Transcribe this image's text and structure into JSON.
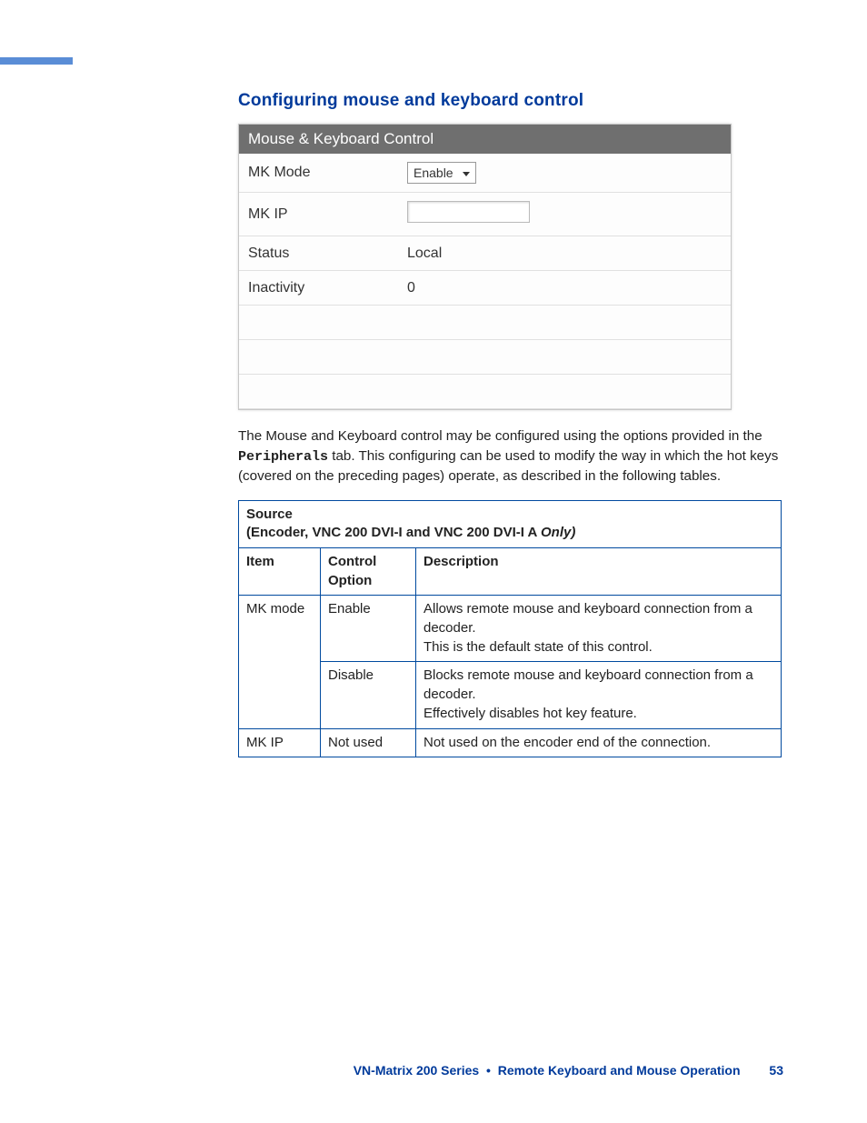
{
  "heading": "Configuring mouse and keyboard control",
  "panel": {
    "title": "Mouse & Keyboard Control",
    "rows": {
      "mk_mode_label": "MK Mode",
      "mk_mode_value": "Enable",
      "mk_ip_label": "MK IP",
      "mk_ip_value": "",
      "status_label": "Status",
      "status_value": "Local",
      "inactivity_label": "Inactivity",
      "inactivity_value": "0"
    }
  },
  "body": {
    "p1_a": "The Mouse and Keyboard control may be configured using the options provided in the ",
    "p1_tab": "Peripherals",
    "p1_b": " tab.  This configuring can be used to modify the way in which the hot keys (covered on the preceding pages) operate, as described in the following tables."
  },
  "table": {
    "source_label": "Source",
    "source_sub_a": "(Encoder,  VNC 200 DVI-I and VNC 200 DVI-I A ",
    "source_sub_b": "Only)",
    "col_item": "Item",
    "col_control": "Control Option",
    "col_desc": "Description",
    "rows": [
      {
        "item": "MK mode",
        "option": "Enable",
        "desc": "Allows remote mouse and keyboard connection from a decoder.\nThis is the default state of this control."
      },
      {
        "item": "",
        "option": "Disable",
        "desc": "Blocks remote mouse and keyboard connection from a decoder.\nEffectively disables hot key feature."
      },
      {
        "item": "MK IP",
        "option": "Not used",
        "desc": "Not used on the encoder end of the connection."
      }
    ]
  },
  "footer": {
    "product": "VN-Matrix 200 Series",
    "section": "Remote Keyboard and Mouse Operation",
    "page": "53"
  }
}
